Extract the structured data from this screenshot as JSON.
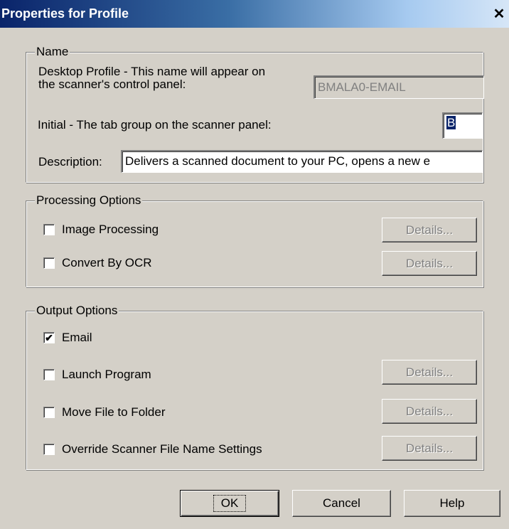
{
  "window": {
    "title": "Properties for Profile",
    "close_glyph": "✕"
  },
  "name_group": {
    "title": "Name",
    "desktop_profile_label_line1": "Desktop Profile - This name will appear on",
    "desktop_profile_label_line2": "the scanner's control panel:",
    "desktop_profile_value": "BMALA0-EMAIL",
    "initial_label": "Initial - The tab group on the scanner panel:",
    "initial_value": "B",
    "description_label": "Description:",
    "description_value": "Delivers a scanned document to your PC, opens a new e"
  },
  "processing_group": {
    "title": "Processing Options",
    "options": [
      {
        "label": "Image Processing",
        "checked": false,
        "details_label": "Details..."
      },
      {
        "label": "Convert By OCR",
        "checked": false,
        "details_label": "Details..."
      }
    ]
  },
  "output_group": {
    "title": "Output Options",
    "email": {
      "label": "Email",
      "checked": true
    },
    "options": [
      {
        "label": "Launch Program",
        "checked": false,
        "details_label": "Details..."
      },
      {
        "label": "Move File to Folder",
        "checked": false,
        "details_label": "Details..."
      },
      {
        "label": "Override Scanner File Name Settings",
        "checked": false,
        "details_label": "Details..."
      }
    ]
  },
  "buttons": {
    "ok": "OK",
    "cancel": "Cancel",
    "help": "Help"
  },
  "checkmark_glyph": "✔"
}
